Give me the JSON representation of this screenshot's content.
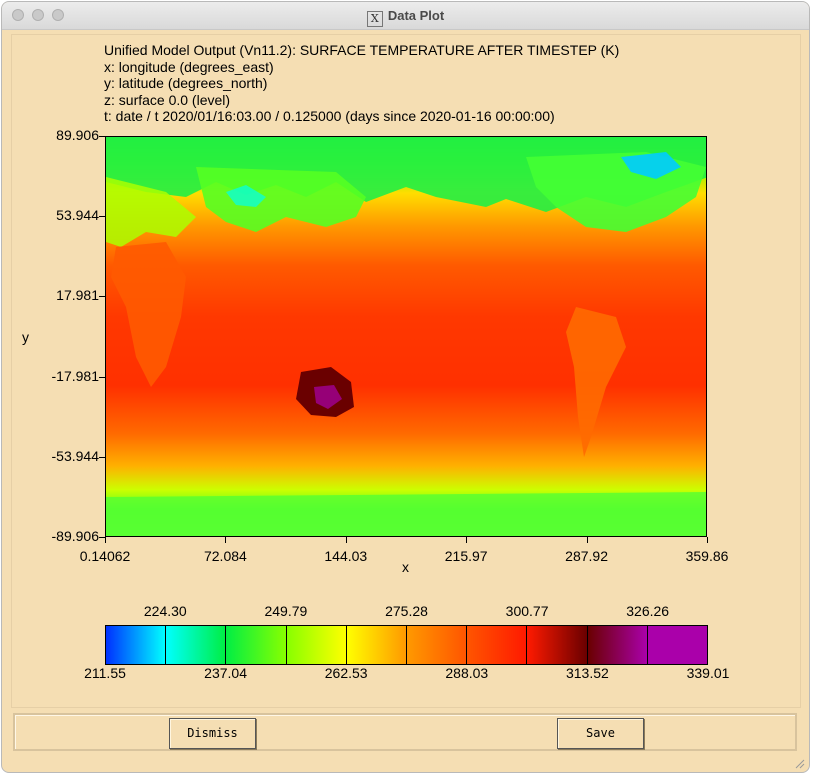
{
  "window": {
    "title": "Data Plot"
  },
  "header": {
    "line1": "Unified Model Output (Vn11.2): SURFACE TEMPERATURE AFTER TIMESTEP (K)",
    "line2": "x: longitude  (degrees_east)",
    "line3": "y: latitude  (degrees_north)",
    "line4": "z: surface 0.0 (level)",
    "line5": "t: date / t 2020/01/16:03.00 / 0.125000 (days since 2020-01-16 00:00:00)"
  },
  "chart_data": {
    "type": "heatmap",
    "xlabel": "x",
    "ylabel": "y",
    "x_ticks": [
      "0.14062",
      "72.084",
      "144.03",
      "215.97",
      "287.92",
      "359.86"
    ],
    "y_ticks": [
      "89.906",
      "53.944",
      "17.981",
      "-17.981",
      "-53.944",
      "-89.906"
    ],
    "xlim": [
      0.14062,
      359.86
    ],
    "ylim": [
      -89.906,
      89.906
    ],
    "colorbar": {
      "upper_labels": [
        "224.30",
        "249.79",
        "275.28",
        "300.77",
        "326.26"
      ],
      "lower_labels": [
        "211.55",
        "237.04",
        "262.53",
        "288.03",
        "313.52",
        "339.01"
      ],
      "range": [
        211.55,
        339.01
      ],
      "colors": [
        "#0030ff",
        "#00ffff",
        "#00ee44",
        "#88ff00",
        "#ffff00",
        "#ff9900",
        "#ff5500",
        "#ff1a00",
        "#6a0000",
        "#aa00aa"
      ]
    }
  },
  "buttons": {
    "dismiss": "Dismiss",
    "save": "Save"
  }
}
